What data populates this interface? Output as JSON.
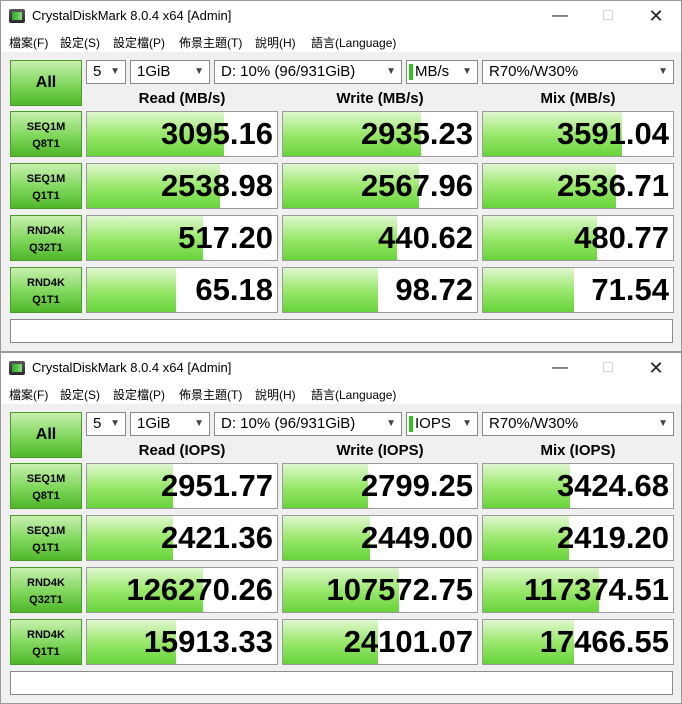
{
  "windows": [
    {
      "title": "CrystalDiskMark 8.0.4 x64 [Admin]",
      "menu": [
        "檔案(F)",
        "設定(S)",
        "設定檔(P)",
        "佈景主題(T)",
        "說明(H)",
        "語言(Language)"
      ],
      "all_label": "All",
      "count": "5",
      "size": "1GiB",
      "drive": "D: 10% (96/931GiB)",
      "unit": "MB/s",
      "mix": "R70%/W30%",
      "headers": [
        "Read (MB/s)",
        "Write (MB/s)",
        "Mix (MB/s)"
      ],
      "rows": [
        {
          "l1": "SEQ1M",
          "l2": "Q8T1",
          "values": [
            "3095.16",
            "2935.23",
            "3591.04"
          ],
          "fill": [
            0.72,
            0.71,
            0.73
          ]
        },
        {
          "l1": "SEQ1M",
          "l2": "Q1T1",
          "values": [
            "2538.98",
            "2567.96",
            "2536.71"
          ],
          "fill": [
            0.7,
            0.7,
            0.7
          ]
        },
        {
          "l1": "RND4K",
          "l2": "Q32T1",
          "values": [
            "517.20",
            "440.62",
            "480.77"
          ],
          "fill": [
            0.61,
            0.59,
            0.6
          ]
        },
        {
          "l1": "RND4K",
          "l2": "Q1T1",
          "values": [
            "65.18",
            "98.72",
            "71.54"
          ],
          "fill": [
            0.47,
            0.49,
            0.48
          ]
        }
      ],
      "comment": ""
    },
    {
      "title": "CrystalDiskMark 8.0.4 x64 [Admin]",
      "menu": [
        "檔案(F)",
        "設定(S)",
        "設定檔(P)",
        "佈景主題(T)",
        "說明(H)",
        "語言(Language)"
      ],
      "all_label": "All",
      "count": "5",
      "size": "1GiB",
      "drive": "D: 10% (96/931GiB)",
      "unit": "IOPS",
      "mix": "R70%/W30%",
      "headers": [
        "Read (IOPS)",
        "Write (IOPS)",
        "Mix (IOPS)"
      ],
      "rows": [
        {
          "l1": "SEQ1M",
          "l2": "Q8T1",
          "values": [
            "2951.77",
            "2799.25",
            "3424.68"
          ],
          "fill": [
            0.45,
            0.44,
            0.46
          ]
        },
        {
          "l1": "SEQ1M",
          "l2": "Q1T1",
          "values": [
            "2421.36",
            "2449.00",
            "2419.20"
          ],
          "fill": [
            0.45,
            0.45,
            0.45
          ]
        },
        {
          "l1": "RND4K",
          "l2": "Q32T1",
          "values": [
            "126270.26",
            "107572.75",
            "117374.51"
          ],
          "fill": [
            0.61,
            0.6,
            0.61
          ]
        },
        {
          "l1": "RND4K",
          "l2": "Q1T1",
          "values": [
            "15913.33",
            "24101.07",
            "17466.55"
          ],
          "fill": [
            0.47,
            0.49,
            0.48
          ]
        }
      ],
      "comment": ""
    }
  ]
}
